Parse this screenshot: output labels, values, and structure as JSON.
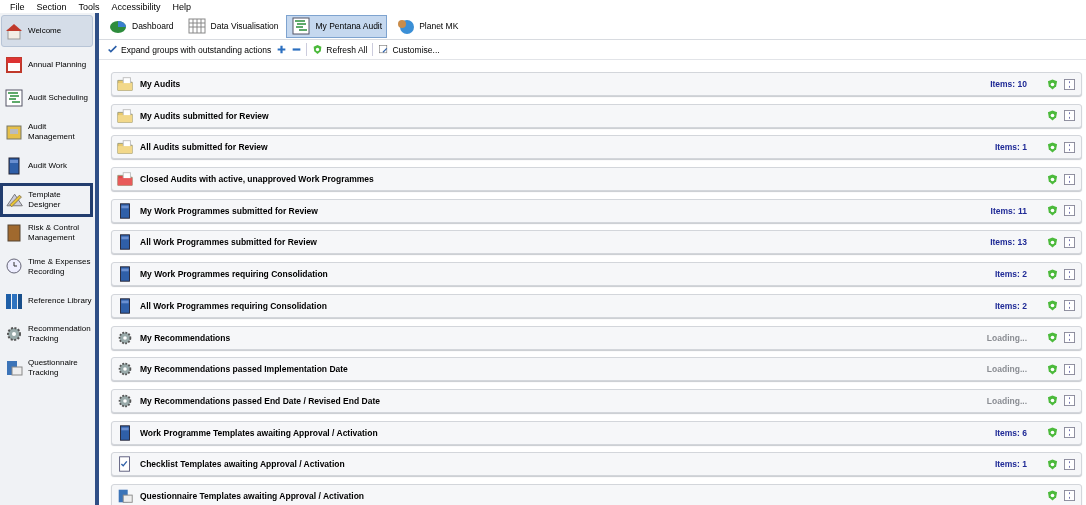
{
  "menu": [
    "File",
    "Section",
    "Tools",
    "Accessibility",
    "Help"
  ],
  "sidebar": {
    "items": [
      {
        "label": "Welcome",
        "kind": "house",
        "selected": true,
        "focused": false
      },
      {
        "label": "Annual Planning",
        "kind": "calendar",
        "selected": false,
        "focused": false
      },
      {
        "label": "Audit Scheduling",
        "kind": "schedule",
        "selected": false,
        "focused": false
      },
      {
        "label": "Audit Management",
        "kind": "box",
        "selected": false,
        "focused": false
      },
      {
        "label": "Audit Work",
        "kind": "cabinet",
        "selected": false,
        "focused": false
      },
      {
        "label": "Template Designer",
        "kind": "pencil",
        "selected": false,
        "focused": true
      },
      {
        "label": "Risk & Control Management",
        "kind": "book",
        "selected": false,
        "focused": false
      },
      {
        "label": "Time & Expenses Recording",
        "kind": "clock",
        "selected": false,
        "focused": false
      },
      {
        "label": "Reference Library",
        "kind": "library",
        "selected": false,
        "focused": false
      },
      {
        "label": "Recommendation Tracking",
        "kind": "gears",
        "selected": false,
        "focused": false
      },
      {
        "label": "Questionnaire Tracking",
        "kind": "questionnaire",
        "selected": false,
        "focused": false
      }
    ]
  },
  "tabs": [
    {
      "label": "Dashboard",
      "kind": "pie",
      "selected": false
    },
    {
      "label": "Data Visualisation",
      "kind": "grid",
      "selected": false
    },
    {
      "label": "My Pentana Audit",
      "kind": "schedule",
      "selected": true
    },
    {
      "label": "Planet MK",
      "kind": "globe",
      "selected": false
    }
  ],
  "toolbar": [
    {
      "kind": "check",
      "label": "Expand groups with outstanding actions"
    },
    {
      "kind": "plus"
    },
    {
      "kind": "minus"
    },
    {
      "kind": "refresh",
      "label": "Refresh All"
    },
    {
      "kind": "customise",
      "label": "Customise..."
    }
  ],
  "groups": [
    {
      "title": "My Audits",
      "kind": "folder",
      "status": {
        "kind": "count",
        "text": "Items: 10"
      }
    },
    {
      "title": "My Audits submitted for Review",
      "kind": "folder"
    },
    {
      "title": "All Audits submitted for Review",
      "kind": "folder",
      "status": {
        "kind": "count",
        "text": "Items: 1"
      }
    },
    {
      "title": "Closed Audits with active, unapproved Work Programmes",
      "kind": "closed-folder"
    },
    {
      "title": "My Work Programmes submitted for Review",
      "kind": "cabinet",
      "status": {
        "kind": "count",
        "text": "Items: 11"
      }
    },
    {
      "title": "All Work Programmes submitted for Review",
      "kind": "cabinet",
      "status": {
        "kind": "count",
        "text": "Items: 13"
      }
    },
    {
      "title": "My Work Programmes requiring Consolidation",
      "kind": "cabinet",
      "status": {
        "kind": "count",
        "text": "Items: 2"
      }
    },
    {
      "title": "All Work Programmes requiring Consolidation",
      "kind": "cabinet",
      "status": {
        "kind": "count",
        "text": "Items: 2"
      }
    },
    {
      "title": "My Recommendations",
      "kind": "gear",
      "status": {
        "kind": "loading",
        "text": "Loading..."
      }
    },
    {
      "title": "My Recommendations passed Implementation Date",
      "kind": "gear",
      "status": {
        "kind": "loading",
        "text": "Loading..."
      }
    },
    {
      "title": "My Recommendations passed End Date / Revised End Date",
      "kind": "gear",
      "status": {
        "kind": "loading",
        "text": "Loading..."
      }
    },
    {
      "title": "Work Programme Templates awaiting Approval / Activation",
      "kind": "cabinet",
      "status": {
        "kind": "count",
        "text": "Items: 6"
      }
    },
    {
      "title": "Checklist Templates awaiting Approval / Activation",
      "kind": "checklist",
      "status": {
        "kind": "count",
        "text": "Items: 1"
      }
    },
    {
      "title": "Questionnaire Templates awaiting Approval / Activation",
      "kind": "questionnaire"
    }
  ]
}
